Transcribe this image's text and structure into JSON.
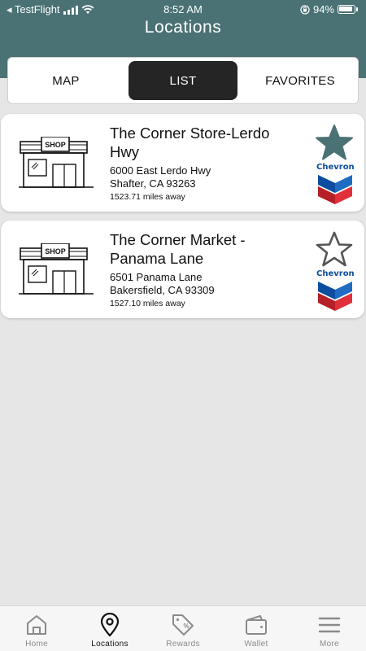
{
  "status_bar": {
    "carrier": "◂ TestFlight",
    "time": "8:52 AM",
    "battery": "94%"
  },
  "header": {
    "title": "Locations"
  },
  "tabs": [
    {
      "label": "MAP",
      "active": false
    },
    {
      "label": "LIST",
      "active": true
    },
    {
      "label": "FAVORITES",
      "active": false
    }
  ],
  "locations": [
    {
      "name": "The Corner Store-Lerdo Hwy",
      "address1": "6000 East Lerdo Hwy",
      "address2": "Shafter, CA 93263",
      "distance": "1523.71 miles away",
      "favorite": true,
      "shop_sign": "SHOP",
      "brand": "Chevron"
    },
    {
      "name": "The Corner Market - Panama Lane",
      "address1": "6501 Panama Lane",
      "address2": "Bakersfield, CA 93309",
      "distance": "1527.10 miles away",
      "favorite": false,
      "shop_sign": "SHOP",
      "brand": "Chevron"
    }
  ],
  "bottom_nav": [
    {
      "label": "Home",
      "icon": "home-icon",
      "active": false
    },
    {
      "label": "Locations",
      "icon": "location-pin-icon",
      "active": true
    },
    {
      "label": "Rewards",
      "icon": "rewards-tag-icon",
      "active": false
    },
    {
      "label": "Wallet",
      "icon": "wallet-icon",
      "active": false
    },
    {
      "label": "More",
      "icon": "menu-icon",
      "active": false
    }
  ],
  "colors": {
    "header_bg": "#4a7173",
    "star_fill": "#4a7173",
    "active_tab_bg": "#252525"
  }
}
